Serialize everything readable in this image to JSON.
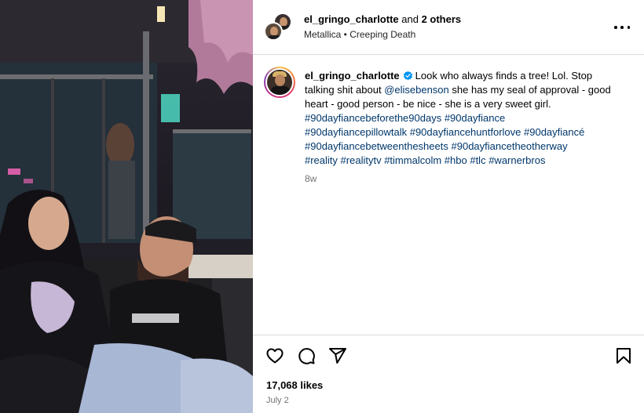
{
  "post": {
    "header": {
      "username": "el_gringo_charlotte",
      "and_text": " and ",
      "others_text": "2 others",
      "audio": "Metallica • Creeping Death"
    },
    "caption": {
      "username": "el_gringo_charlotte",
      "text_1": "Look who always finds a tree! Lol. Stop talking shit about ",
      "mention": "@elisebenson",
      "text_2": " she has my seal of approval - good heart - good person - be nice - she is a very sweet girl.",
      "hashtags": [
        "#90dayfiancebeforethe90days",
        "#90dayfiance",
        "#90dayfiancepillowtalk",
        "#90dayfiancehuntforlove",
        "#90dayfiancé",
        "#90dayfiancebetweenthesheets",
        "#90dayfiancetheotherway",
        "#reality",
        "#realitytv",
        "#timmalcolm",
        "#hbo",
        "#tlc",
        "#warnerbros"
      ],
      "age": "8w"
    },
    "likes": "17,068 likes",
    "date": "July 2"
  },
  "icons": {
    "more": "more-options-icon",
    "verified": "verified-badge-icon",
    "like": "heart-icon",
    "comment": "comment-icon",
    "share": "share-icon",
    "save": "bookmark-icon"
  },
  "colors": {
    "link": "#00376b",
    "muted": "#737373",
    "verified": "#0095f6",
    "divider": "#dbdbdb"
  }
}
